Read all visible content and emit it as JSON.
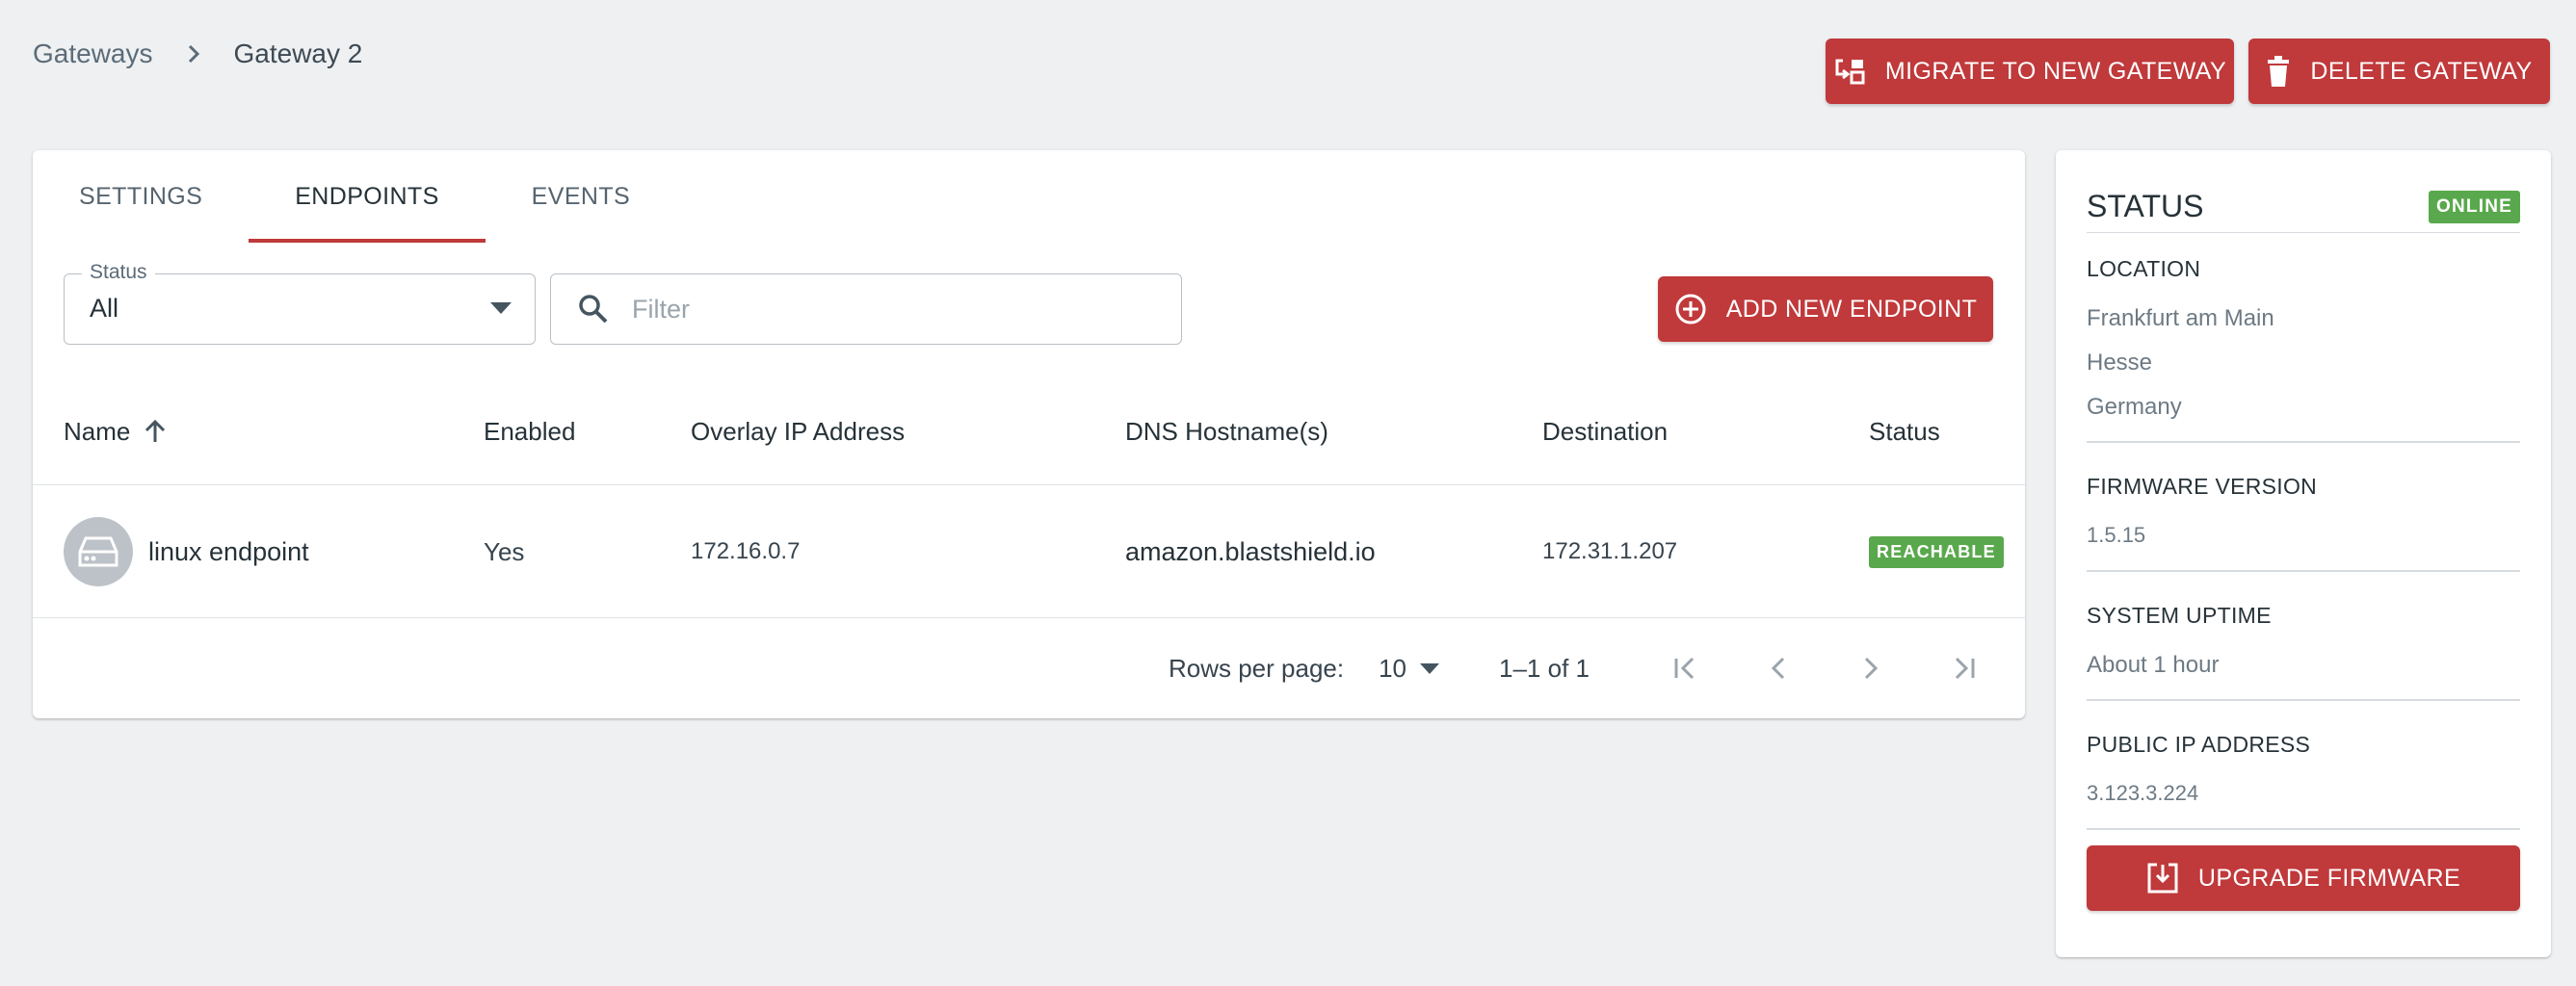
{
  "breadcrumb": {
    "parent": "Gateways",
    "current": "Gateway 2"
  },
  "actions": {
    "migrate_label": "MIGRATE TO NEW GATEWAY",
    "delete_label": "DELETE GATEWAY"
  },
  "tabs": [
    {
      "label": "SETTINGS",
      "active": false
    },
    {
      "label": "ENDPOINTS",
      "active": true
    },
    {
      "label": "EVENTS",
      "active": false
    }
  ],
  "filters": {
    "status_label": "Status",
    "status_value": "All",
    "filter_placeholder": "Filter"
  },
  "add_endpoint_label": "ADD NEW ENDPOINT",
  "table": {
    "columns": [
      "Name",
      "Enabled",
      "Overlay IP Address",
      "DNS Hostname(s)",
      "Destination",
      "Status"
    ],
    "rows": [
      {
        "name": "linux endpoint",
        "enabled": "Yes",
        "overlay_ip": "172.16.0.7",
        "dns": "amazon.blastshield.io",
        "destination": "172.31.1.207",
        "status": "REACHABLE"
      }
    ]
  },
  "pagination": {
    "rows_per_page_label": "Rows per page:",
    "rows_per_page": "10",
    "range": "1–1 of 1"
  },
  "status_panel": {
    "title": "STATUS",
    "badge": "ONLINE",
    "location_label": "LOCATION",
    "location_city": "Frankfurt am Main",
    "location_state": "Hesse",
    "location_country": "Germany",
    "firmware_label": "FIRMWARE VERSION",
    "firmware_value": "1.5.15",
    "uptime_label": "SYSTEM UPTIME",
    "uptime_value": "About 1 hour",
    "ip_label": "PUBLIC IP ADDRESS",
    "ip_value": "3.123.3.224",
    "upgrade_label": "UPGRADE FIRMWARE"
  },
  "colors": {
    "accent": "#c0393b",
    "success": "#5aa84d",
    "background": "#eef0f2"
  }
}
